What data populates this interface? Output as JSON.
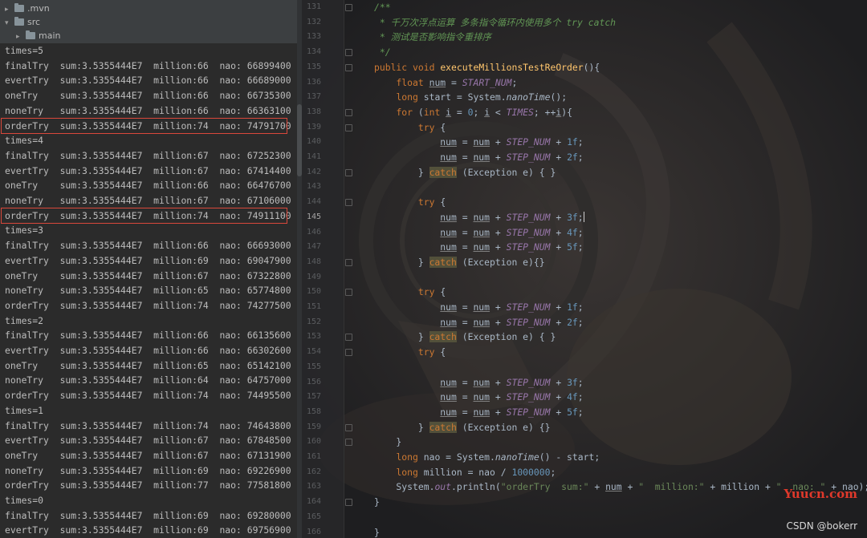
{
  "project_tree": [
    {
      "name": ".mvn",
      "expanded": false
    },
    {
      "name": "src",
      "expanded": true
    },
    {
      "name": "main",
      "expanded": false
    }
  ],
  "console_lines": [
    {
      "text": "times=5",
      "highlighted": false
    },
    {
      "text": "finalTry  sum:3.5355444E7  million:66  nao: 66899400",
      "highlighted": false
    },
    {
      "text": "evertTry  sum:3.5355444E7  million:66  nao: 66689000",
      "highlighted": false
    },
    {
      "text": "oneTry    sum:3.5355444E7  million:66  nao: 66735300",
      "highlighted": false
    },
    {
      "text": "noneTry   sum:3.5355444E7  million:66  nao: 66363100",
      "highlighted": false
    },
    {
      "text": "orderTry  sum:3.5355444E7  million:74  nao: 74791700",
      "highlighted": true
    },
    {
      "text": "times=4",
      "highlighted": false
    },
    {
      "text": "finalTry  sum:3.5355444E7  million:67  nao: 67252300",
      "highlighted": false
    },
    {
      "text": "evertTry  sum:3.5355444E7  million:67  nao: 67414400",
      "highlighted": false
    },
    {
      "text": "oneTry    sum:3.5355444E7  million:66  nao: 66476700",
      "highlighted": false
    },
    {
      "text": "noneTry   sum:3.5355444E7  million:67  nao: 67106000",
      "highlighted": false
    },
    {
      "text": "orderTry  sum:3.5355444E7  million:74  nao: 74911100",
      "highlighted": true
    },
    {
      "text": "times=3",
      "highlighted": false
    },
    {
      "text": "finalTry  sum:3.5355444E7  million:66  nao: 66693000",
      "highlighted": false
    },
    {
      "text": "evertTry  sum:3.5355444E7  million:69  nao: 69047900",
      "highlighted": false
    },
    {
      "text": "oneTry    sum:3.5355444E7  million:67  nao: 67322800",
      "highlighted": false
    },
    {
      "text": "noneTry   sum:3.5355444E7  million:65  nao: 65774800",
      "highlighted": false
    },
    {
      "text": "orderTry  sum:3.5355444E7  million:74  nao: 74277500",
      "highlighted": false
    },
    {
      "text": "times=2",
      "highlighted": false
    },
    {
      "text": "finalTry  sum:3.5355444E7  million:66  nao: 66135600",
      "highlighted": false
    },
    {
      "text": "evertTry  sum:3.5355444E7  million:66  nao: 66302600",
      "highlighted": false
    },
    {
      "text": "oneTry    sum:3.5355444E7  million:65  nao: 65142100",
      "highlighted": false
    },
    {
      "text": "noneTry   sum:3.5355444E7  million:64  nao: 64757000",
      "highlighted": false
    },
    {
      "text": "orderTry  sum:3.5355444E7  million:74  nao: 74495500",
      "highlighted": false
    },
    {
      "text": "times=1",
      "highlighted": false
    },
    {
      "text": "finalTry  sum:3.5355444E7  million:74  nao: 74643800",
      "highlighted": false
    },
    {
      "text": "evertTry  sum:3.5355444E7  million:67  nao: 67848500",
      "highlighted": false
    },
    {
      "text": "oneTry    sum:3.5355444E7  million:67  nao: 67131900",
      "highlighted": false
    },
    {
      "text": "noneTry   sum:3.5355444E7  million:69  nao: 69226900",
      "highlighted": false
    },
    {
      "text": "orderTry  sum:3.5355444E7  million:77  nao: 77581800",
      "highlighted": false
    },
    {
      "text": "times=0",
      "highlighted": false
    },
    {
      "text": "finalTry  sum:3.5355444E7  million:69  nao: 69280000",
      "highlighted": false
    },
    {
      "text": "evertTry  sum:3.5355444E7  million:69  nao: 69756900",
      "highlighted": false
    }
  ],
  "editor": {
    "current_line": 145,
    "lines": [
      {
        "n": 131,
        "fold": true,
        "tokens": [
          [
            "doc",
            "/**"
          ]
        ]
      },
      {
        "n": 132,
        "fold": false,
        "tokens": [
          [
            "doc",
            " * 千万次浮点运算 多条指令循环内使用多个 try catch"
          ]
        ]
      },
      {
        "n": 133,
        "fold": false,
        "tokens": [
          [
            "doc",
            " * 测试是否影响指令重排序"
          ]
        ]
      },
      {
        "n": 134,
        "fold": true,
        "tokens": [
          [
            "doc",
            " */"
          ]
        ]
      },
      {
        "n": 135,
        "fold": true,
        "tokens": [
          [
            "kw",
            "public "
          ],
          [
            "kw",
            "void "
          ],
          [
            "meth",
            "executeMillionsTestReOrder"
          ],
          [
            "",
            "(){"
          ]
        ]
      },
      {
        "n": 136,
        "fold": false,
        "tokens": [
          [
            "",
            "    "
          ],
          [
            "kw",
            "float "
          ],
          [
            "ul",
            "num"
          ],
          [
            "",
            " = "
          ],
          [
            "fld",
            "START_NUM"
          ],
          [
            "",
            ";"
          ]
        ]
      },
      {
        "n": 137,
        "fold": false,
        "tokens": [
          [
            "",
            "    "
          ],
          [
            "kw",
            "long "
          ],
          [
            "",
            "start = System."
          ],
          [
            "stat",
            "nanoTime"
          ],
          [
            "",
            "();"
          ]
        ]
      },
      {
        "n": 138,
        "fold": true,
        "tokens": [
          [
            "",
            "    "
          ],
          [
            "kw",
            "for "
          ],
          [
            "",
            "("
          ],
          [
            "kw",
            "int "
          ],
          [
            "ul",
            "i"
          ],
          [
            "",
            " = "
          ],
          [
            "num",
            "0"
          ],
          [
            "",
            "; "
          ],
          [
            "ul",
            "i"
          ],
          [
            "",
            " < "
          ],
          [
            "fld",
            "TIMES"
          ],
          [
            "",
            "; ++"
          ],
          [
            "ul",
            "i"
          ],
          [
            "",
            "){"
          ]
        ]
      },
      {
        "n": 139,
        "fold": true,
        "tokens": [
          [
            "",
            "        "
          ],
          [
            "kw",
            "try "
          ],
          [
            "",
            "{"
          ]
        ]
      },
      {
        "n": 140,
        "fold": false,
        "tokens": [
          [
            "",
            "            "
          ],
          [
            "ul",
            "num"
          ],
          [
            "",
            " = "
          ],
          [
            "ul",
            "num"
          ],
          [
            "",
            " + "
          ],
          [
            "fld",
            "STEP_NUM"
          ],
          [
            "",
            " + "
          ],
          [
            "num",
            "1f"
          ],
          [
            "",
            ";"
          ]
        ]
      },
      {
        "n": 141,
        "fold": false,
        "tokens": [
          [
            "",
            "            "
          ],
          [
            "ul",
            "num"
          ],
          [
            "",
            " = "
          ],
          [
            "ul",
            "num"
          ],
          [
            "",
            " + "
          ],
          [
            "fld",
            "STEP_NUM"
          ],
          [
            "",
            " + "
          ],
          [
            "num",
            "2f"
          ],
          [
            "",
            ";"
          ]
        ]
      },
      {
        "n": 142,
        "fold": true,
        "tokens": [
          [
            "",
            "        } "
          ],
          [
            "catch",
            "catch"
          ],
          [
            "",
            " (Exception e) { }"
          ]
        ]
      },
      {
        "n": 143,
        "fold": false,
        "tokens": [
          [
            "",
            ""
          ]
        ]
      },
      {
        "n": 144,
        "fold": true,
        "tokens": [
          [
            "",
            "        "
          ],
          [
            "kw",
            "try "
          ],
          [
            "",
            "{"
          ]
        ]
      },
      {
        "n": 145,
        "fold": false,
        "tokens": [
          [
            "",
            "            "
          ],
          [
            "ul",
            "num"
          ],
          [
            "",
            " = "
          ],
          [
            "ul",
            "num"
          ],
          [
            "",
            " + "
          ],
          [
            "fld",
            "STEP_NUM"
          ],
          [
            "",
            " + "
          ],
          [
            "num",
            "3f"
          ],
          [
            "",
            ";"
          ],
          [
            "caret",
            ""
          ]
        ]
      },
      {
        "n": 146,
        "fold": false,
        "tokens": [
          [
            "",
            "            "
          ],
          [
            "ul",
            "num"
          ],
          [
            "",
            " = "
          ],
          [
            "ul",
            "num"
          ],
          [
            "",
            " + "
          ],
          [
            "fld",
            "STEP_NUM"
          ],
          [
            "",
            " + "
          ],
          [
            "num",
            "4f"
          ],
          [
            "",
            ";"
          ]
        ]
      },
      {
        "n": 147,
        "fold": false,
        "tokens": [
          [
            "",
            "            "
          ],
          [
            "ul",
            "num"
          ],
          [
            "",
            " = "
          ],
          [
            "ul",
            "num"
          ],
          [
            "",
            " + "
          ],
          [
            "fld",
            "STEP_NUM"
          ],
          [
            "",
            " + "
          ],
          [
            "num",
            "5f"
          ],
          [
            "",
            ";"
          ]
        ]
      },
      {
        "n": 148,
        "fold": true,
        "tokens": [
          [
            "",
            "        } "
          ],
          [
            "catch",
            "catch"
          ],
          [
            "",
            " (Exception e){}"
          ]
        ]
      },
      {
        "n": 149,
        "fold": false,
        "tokens": [
          [
            "",
            ""
          ]
        ]
      },
      {
        "n": 150,
        "fold": true,
        "tokens": [
          [
            "",
            "        "
          ],
          [
            "kw",
            "try "
          ],
          [
            "",
            "{"
          ]
        ]
      },
      {
        "n": 151,
        "fold": false,
        "tokens": [
          [
            "",
            "            "
          ],
          [
            "ul",
            "num"
          ],
          [
            "",
            " = "
          ],
          [
            "ul",
            "num"
          ],
          [
            "",
            " + "
          ],
          [
            "fld",
            "STEP_NUM"
          ],
          [
            "",
            " + "
          ],
          [
            "num",
            "1f"
          ],
          [
            "",
            ";"
          ]
        ]
      },
      {
        "n": 152,
        "fold": false,
        "tokens": [
          [
            "",
            "            "
          ],
          [
            "ul",
            "num"
          ],
          [
            "",
            " = "
          ],
          [
            "ul",
            "num"
          ],
          [
            "",
            " + "
          ],
          [
            "fld",
            "STEP_NUM"
          ],
          [
            "",
            " + "
          ],
          [
            "num",
            "2f"
          ],
          [
            "",
            ";"
          ]
        ]
      },
      {
        "n": 153,
        "fold": true,
        "tokens": [
          [
            "",
            "        } "
          ],
          [
            "catch",
            "catch"
          ],
          [
            "",
            " (Exception e) { }"
          ]
        ]
      },
      {
        "n": 154,
        "fold": true,
        "tokens": [
          [
            "",
            "        "
          ],
          [
            "kw",
            "try "
          ],
          [
            "",
            "{"
          ]
        ]
      },
      {
        "n": 155,
        "fold": false,
        "tokens": [
          [
            "",
            ""
          ]
        ]
      },
      {
        "n": 156,
        "fold": false,
        "tokens": [
          [
            "",
            "            "
          ],
          [
            "ul",
            "num"
          ],
          [
            "",
            " = "
          ],
          [
            "ul",
            "num"
          ],
          [
            "",
            " + "
          ],
          [
            "fld",
            "STEP_NUM"
          ],
          [
            "",
            " + "
          ],
          [
            "num",
            "3f"
          ],
          [
            "",
            ";"
          ]
        ]
      },
      {
        "n": 157,
        "fold": false,
        "tokens": [
          [
            "",
            "            "
          ],
          [
            "ul",
            "num"
          ],
          [
            "",
            " = "
          ],
          [
            "ul",
            "num"
          ],
          [
            "",
            " + "
          ],
          [
            "fld",
            "STEP_NUM"
          ],
          [
            "",
            " + "
          ],
          [
            "num",
            "4f"
          ],
          [
            "",
            ";"
          ]
        ]
      },
      {
        "n": 158,
        "fold": false,
        "tokens": [
          [
            "",
            "            "
          ],
          [
            "ul",
            "num"
          ],
          [
            "",
            " = "
          ],
          [
            "ul",
            "num"
          ],
          [
            "",
            " + "
          ],
          [
            "fld",
            "STEP_NUM"
          ],
          [
            "",
            " + "
          ],
          [
            "num",
            "5f"
          ],
          [
            "",
            ";"
          ]
        ]
      },
      {
        "n": 159,
        "fold": true,
        "tokens": [
          [
            "",
            "        } "
          ],
          [
            "catch",
            "catch"
          ],
          [
            "",
            " (Exception e) {}"
          ]
        ]
      },
      {
        "n": 160,
        "fold": true,
        "tokens": [
          [
            "",
            "    }"
          ]
        ]
      },
      {
        "n": 161,
        "fold": false,
        "tokens": [
          [
            "",
            "    "
          ],
          [
            "kw",
            "long "
          ],
          [
            "",
            "nao = System."
          ],
          [
            "stat",
            "nanoTime"
          ],
          [
            "",
            "() - start;"
          ]
        ]
      },
      {
        "n": 162,
        "fold": false,
        "tokens": [
          [
            "",
            "    "
          ],
          [
            "kw",
            "long "
          ],
          [
            "",
            "million = nao / "
          ],
          [
            "num",
            "1000000"
          ],
          [
            "",
            ";"
          ]
        ]
      },
      {
        "n": 163,
        "fold": false,
        "tokens": [
          [
            "",
            "    System."
          ],
          [
            "fld",
            "out"
          ],
          [
            "",
            ".println("
          ],
          [
            "str",
            "\"orderTry  sum:\""
          ],
          [
            "",
            " + "
          ],
          [
            "ul",
            "num"
          ],
          [
            "",
            " + "
          ],
          [
            "str",
            "\"  million:\""
          ],
          [
            "",
            " + million + "
          ],
          [
            "str",
            "\"  nao: \""
          ],
          [
            "",
            " + nao);"
          ]
        ]
      },
      {
        "n": 164,
        "fold": true,
        "tokens": [
          [
            "",
            "}"
          ]
        ]
      },
      {
        "n": 165,
        "fold": false,
        "tokens": [
          [
            "",
            ""
          ]
        ]
      },
      {
        "n": 166,
        "fold": false,
        "tokens": [
          [
            "",
            "}"
          ]
        ]
      }
    ]
  },
  "watermarks": {
    "site": "Yuucn.com",
    "author": "CSDN @bokerr"
  },
  "colors": {
    "highlight_box": "#d9483b",
    "keyword": "#cc7832",
    "field": "#9876aa",
    "number": "#6897bb",
    "string": "#6a8759",
    "doc": "#629755",
    "method": "#ffc66d"
  }
}
